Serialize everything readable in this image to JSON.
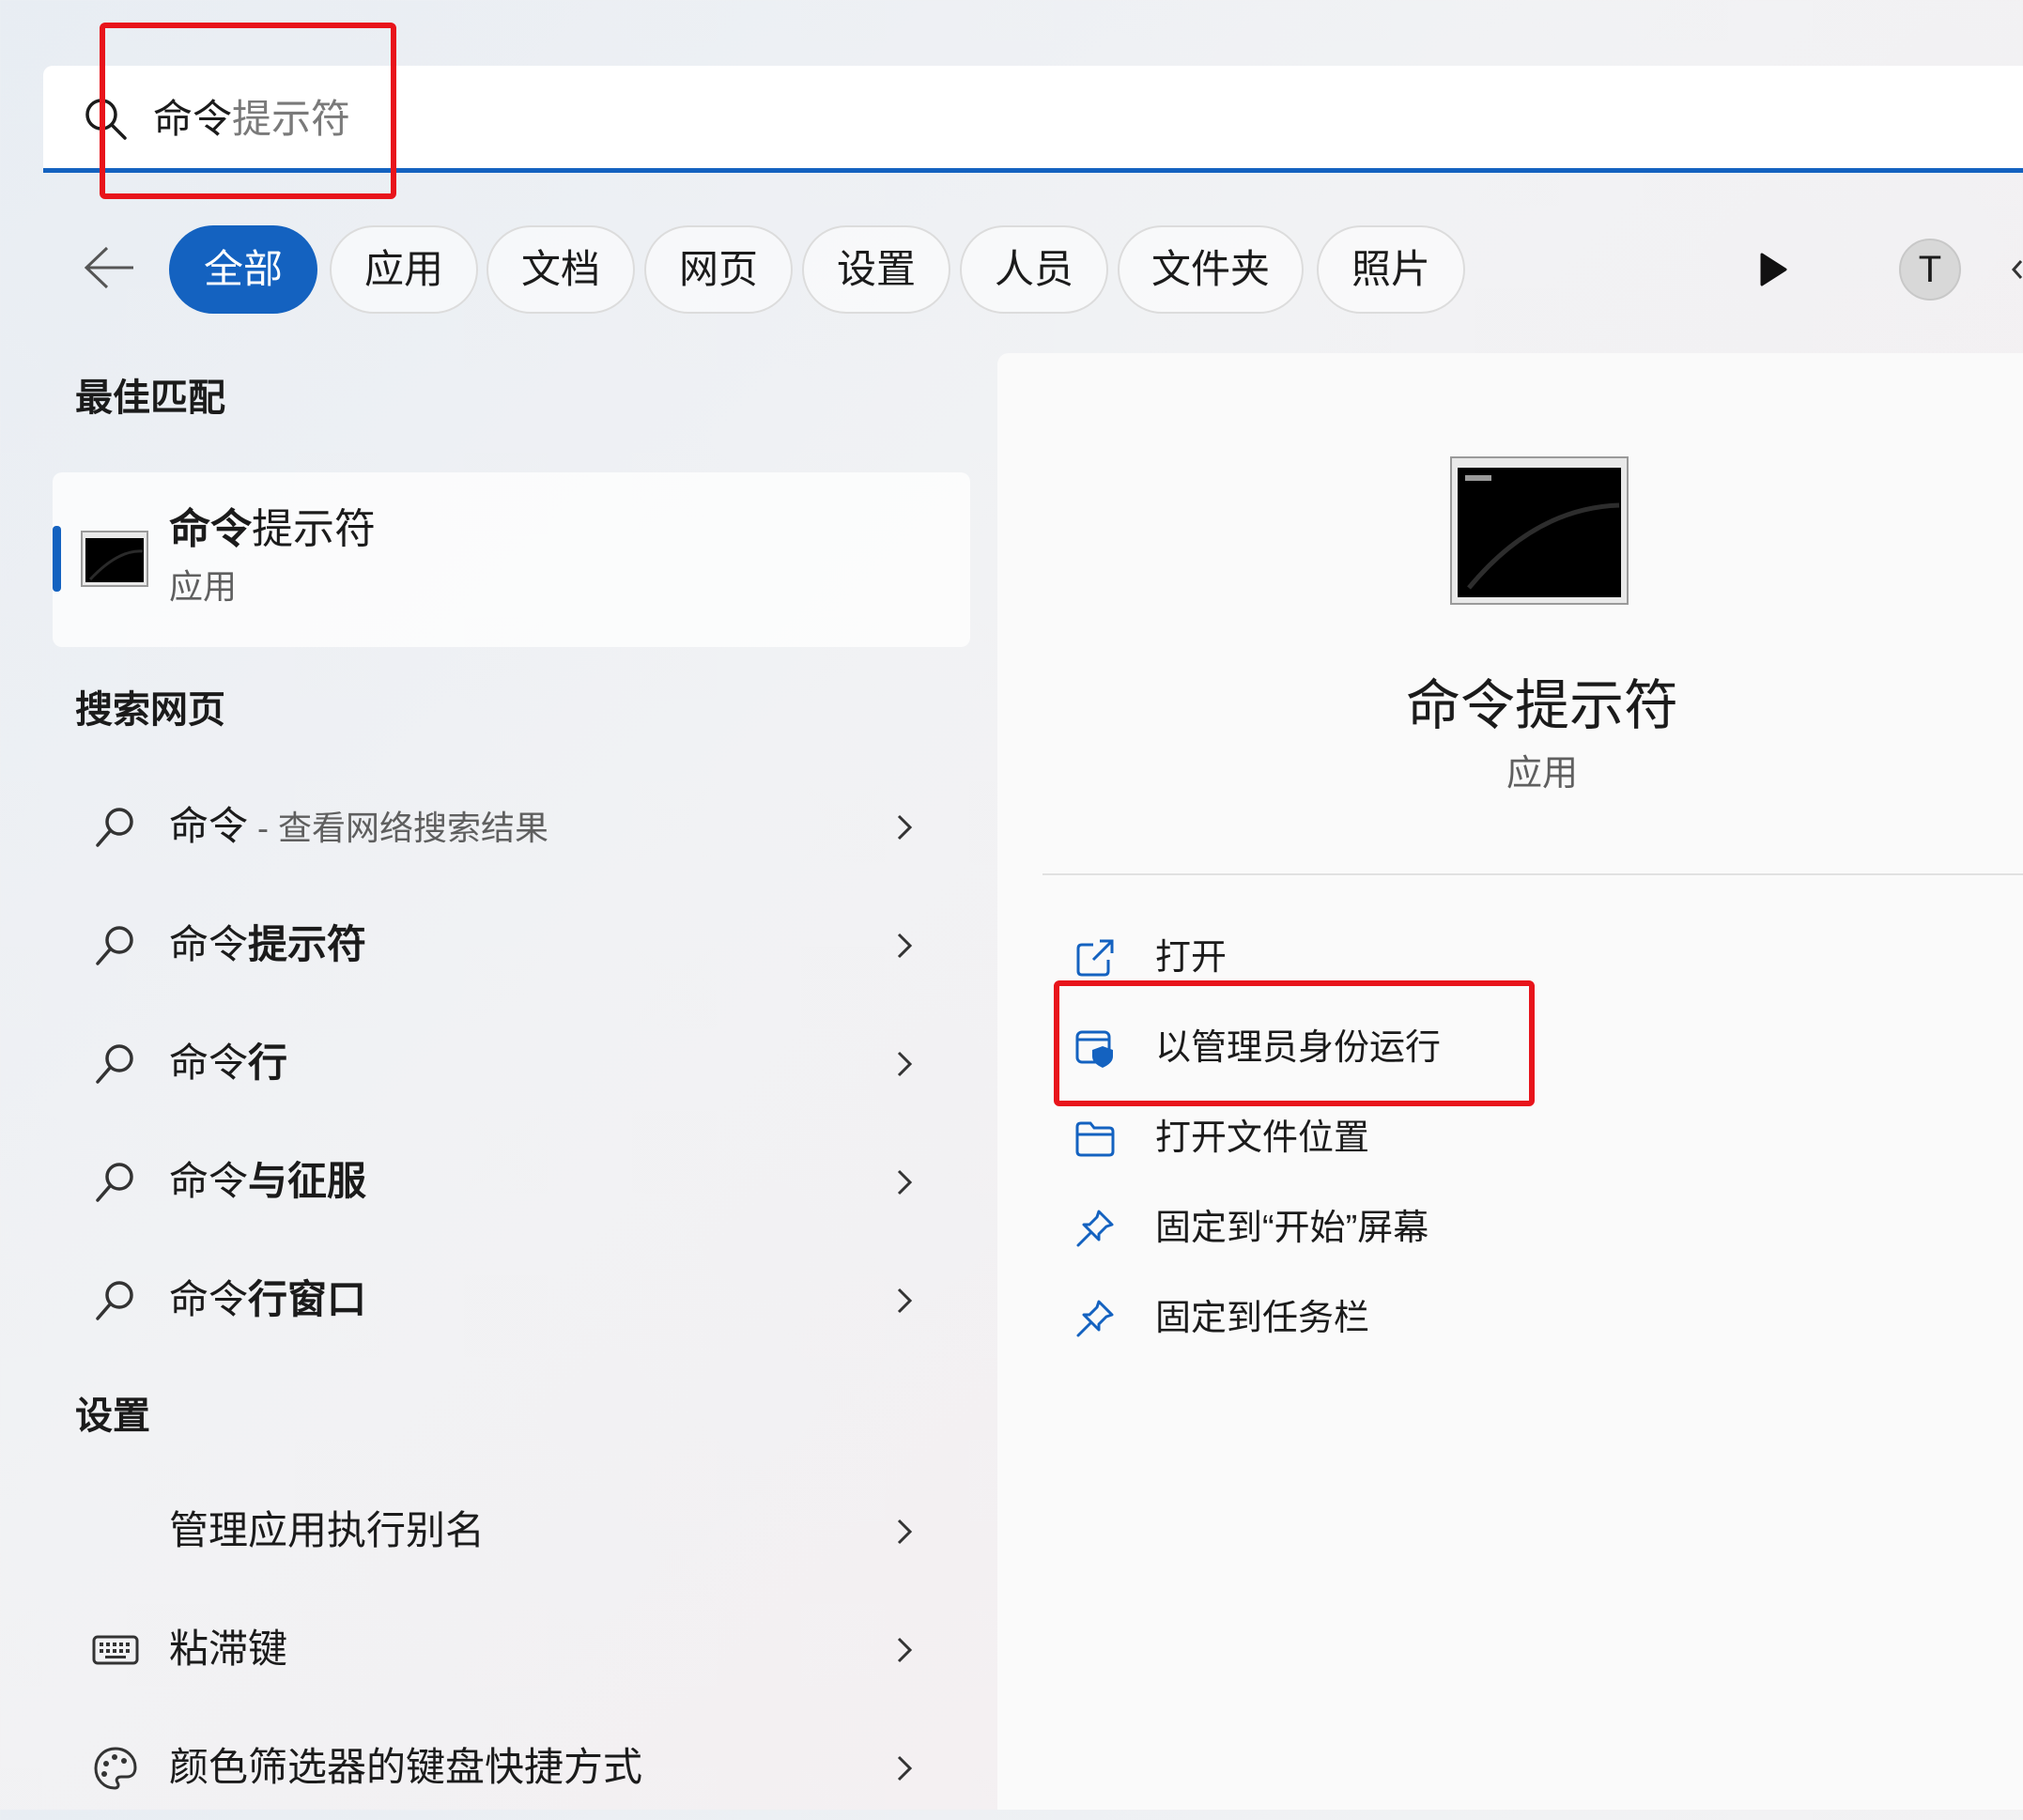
{
  "search": {
    "typed": "命令",
    "suggestion": "提示符"
  },
  "filters": [
    {
      "label": "全部",
      "active": true
    },
    {
      "label": "应用",
      "active": false
    },
    {
      "label": "文档",
      "active": false
    },
    {
      "label": "网页",
      "active": false
    },
    {
      "label": "设置",
      "active": false
    },
    {
      "label": "人员",
      "active": false
    },
    {
      "label": "文件夹",
      "active": false
    },
    {
      "label": "照片",
      "active": false
    }
  ],
  "user": {
    "avatar_initial": "T"
  },
  "best_match": {
    "heading": "最佳匹配",
    "name_bold": "命令",
    "name_rest": "提示符",
    "type": "应用",
    "icon": "command-prompt-icon"
  },
  "web_search": {
    "heading": "搜索网页",
    "items": [
      {
        "prefix": "命令",
        "bold": "",
        "detail": " - 查看网络搜索结果"
      },
      {
        "prefix": "命令",
        "bold": "提示符",
        "detail": ""
      },
      {
        "prefix": "命令",
        "bold": "行",
        "detail": ""
      },
      {
        "prefix": "命令",
        "bold": "与征服",
        "detail": ""
      },
      {
        "prefix": "命令",
        "bold": "行窗口",
        "detail": ""
      }
    ]
  },
  "settings": {
    "heading": "设置",
    "items": [
      {
        "label": "管理应用执行别名",
        "icon": "none"
      },
      {
        "label": "粘滞键",
        "icon": "keyboard-icon"
      },
      {
        "label": "颜色筛选器的键盘快捷方式",
        "icon": "palette-icon"
      }
    ]
  },
  "detail": {
    "name": "命令提示符",
    "type": "应用",
    "actions": [
      {
        "label": "打开",
        "icon": "open-external-icon"
      },
      {
        "label": "以管理员身份运行",
        "icon": "shield-admin-icon"
      },
      {
        "label": "打开文件位置",
        "icon": "folder-icon"
      },
      {
        "label": "固定到“开始”屏幕",
        "icon": "pin-icon"
      },
      {
        "label": "固定到任务栏",
        "icon": "pin-icon"
      }
    ]
  },
  "colors": {
    "accent": "#1462c0",
    "highlight": "#e8141b"
  }
}
